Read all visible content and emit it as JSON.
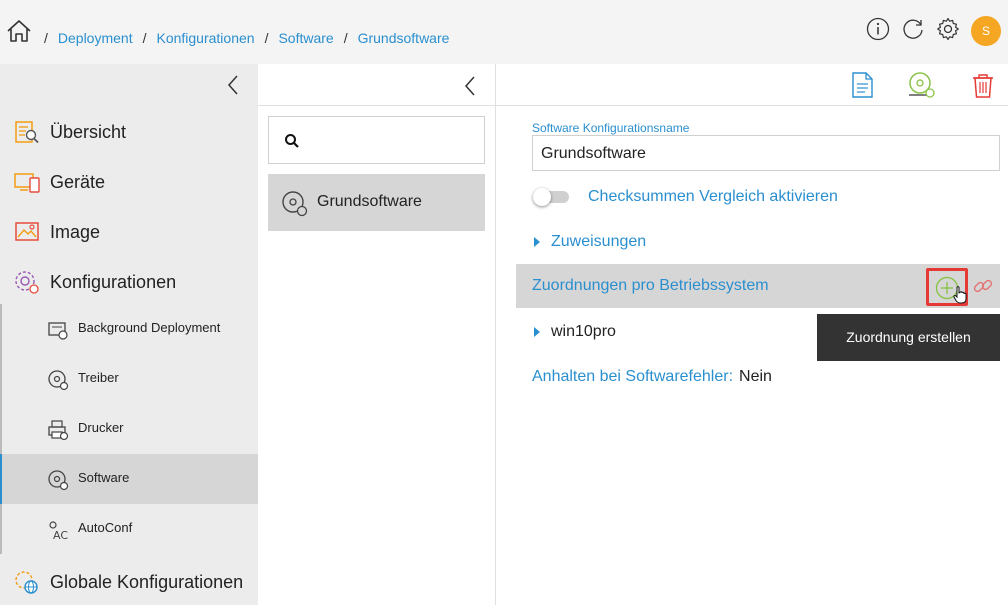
{
  "header": {
    "breadcrumbs": [
      "Deployment",
      "Konfigurationen",
      "Software",
      "Grundsoftware"
    ],
    "avatar_initial": "S",
    "icons": [
      "home-icon",
      "info-icon",
      "refresh-icon",
      "gear-icon"
    ]
  },
  "nav": {
    "main_items": [
      {
        "label": "Übersicht",
        "icon": "overview-icon"
      },
      {
        "label": "Geräte",
        "icon": "devices-icon"
      },
      {
        "label": "Image",
        "icon": "image-icon"
      },
      {
        "label": "Konfigurationen",
        "icon": "config-gear-icon"
      }
    ],
    "sub_items": [
      {
        "label": "Background Deployment",
        "icon": "background-deployment-icon"
      },
      {
        "label": "Treiber",
        "icon": "disc-icon"
      },
      {
        "label": "Drucker",
        "icon": "printer-icon"
      },
      {
        "label": "Software",
        "icon": "software-disc-icon",
        "active": true
      },
      {
        "label": "AutoConf",
        "icon": "autoconf-icon"
      }
    ],
    "global_item": {
      "label": "Globale Konfigurationen",
      "icon": "globe-gear-icon"
    }
  },
  "middle": {
    "search_placeholder": "",
    "items": [
      {
        "label": "Grundsoftware",
        "selected": true
      }
    ]
  },
  "toolbar": {
    "icons": [
      "document-icon",
      "disc-deploy-icon",
      "trash-icon"
    ]
  },
  "detail": {
    "name_label": "Software Konfigurationsname",
    "name_value": "Grundsoftware",
    "checksum_toggle": {
      "label": "Checksummen Vergleich aktivieren",
      "enabled": false
    },
    "zuweisungen_label": "Zuweisungen",
    "section_label": "Zuordnungen pro Betriebssystem",
    "os_item": "win10pro",
    "tooltip": "Zuordnung erstellen",
    "halt_label": "Anhalten bei Softwarefehler:",
    "halt_value": "Nein"
  },
  "colors": {
    "accent": "#2a8fcf",
    "highlight_red": "#e53935",
    "add_green": "#8bc34a",
    "avatar": "#f5a623"
  }
}
